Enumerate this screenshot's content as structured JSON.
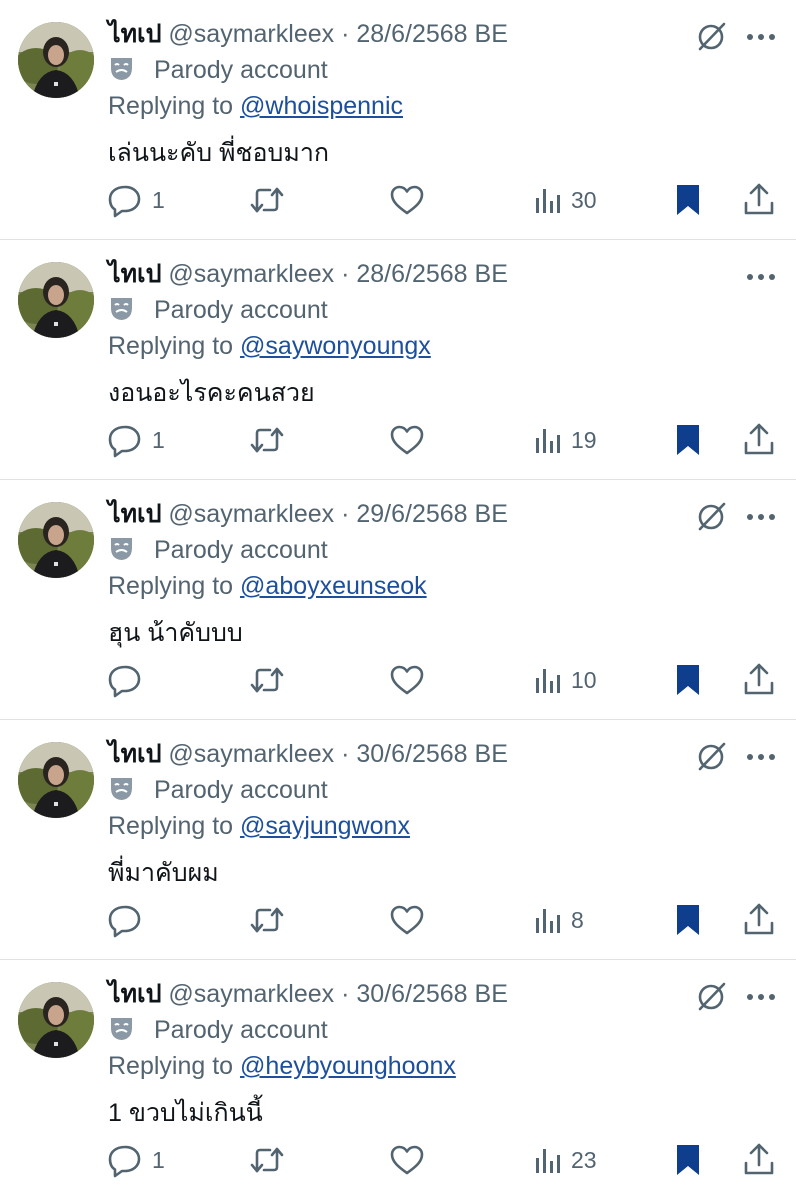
{
  "colors": {
    "text_primary": "#0f1419",
    "text_secondary": "#536471",
    "link": "#1d4f9c",
    "bookmark_active": "#0f3f8c",
    "divider": "#dfe3e8"
  },
  "posts": [
    {
      "display_name": "ไทเป",
      "handle": "@saymarkleex",
      "separator": "·",
      "date": "28/6/2568 BE",
      "show_grok_icon": true,
      "parody_label": "Parody account",
      "replying_prefix": "Replying to",
      "replying_to": "@whoispennic",
      "text": "เล่นนะคับ พี่ชอบมาก",
      "reply_count": "1",
      "views": "30",
      "bookmarked": true
    },
    {
      "display_name": "ไทเป",
      "handle": "@saymarkleex",
      "separator": "·",
      "date": "28/6/2568 BE",
      "show_grok_icon": false,
      "parody_label": "Parody account",
      "replying_prefix": "Replying to",
      "replying_to": "@saywonyoungx",
      "text": "งอนอะไรคะคนสวย",
      "reply_count": "1",
      "views": "19",
      "bookmarked": true
    },
    {
      "display_name": "ไทเป",
      "handle": "@saymarkleex",
      "separator": "·",
      "date": "29/6/2568 BE",
      "show_grok_icon": true,
      "parody_label": "Parody account",
      "replying_prefix": "Replying to",
      "replying_to": "@aboyxeunseok",
      "text": "ฮุน น้าคับบบ",
      "reply_count": "",
      "views": "10",
      "bookmarked": true
    },
    {
      "display_name": "ไทเป",
      "handle": "@saymarkleex",
      "separator": "·",
      "date": "30/6/2568 BE",
      "show_grok_icon": true,
      "parody_label": "Parody account",
      "replying_prefix": "Replying to",
      "replying_to": "@sayjungwonx",
      "text": "พี่มาคับผม",
      "reply_count": "",
      "views": "8",
      "bookmarked": true
    },
    {
      "display_name": "ไทเป",
      "handle": "@saymarkleex",
      "separator": "·",
      "date": "30/6/2568 BE",
      "show_grok_icon": true,
      "parody_label": "Parody account",
      "replying_prefix": "Replying to",
      "replying_to": "@heybyounghoonx",
      "text": "1 ขวบไม่เกินนี้",
      "reply_count": "1",
      "views": "23",
      "bookmarked": true
    }
  ]
}
